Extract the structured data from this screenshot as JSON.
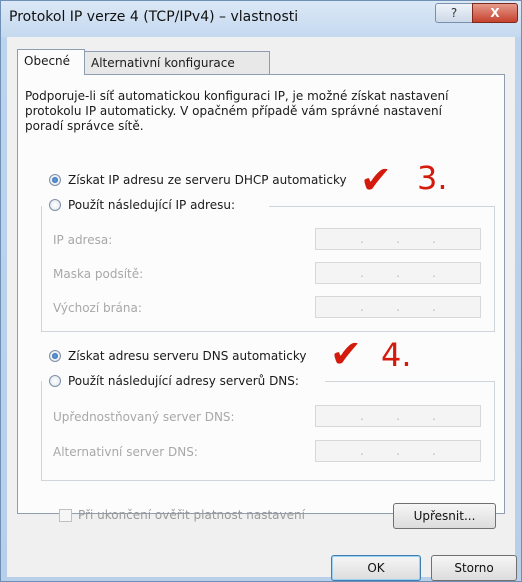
{
  "window": {
    "title": "Protokol IP verze 4 (TCP/IPv4) – vlastnosti",
    "help_label": "?",
    "close_label": "X"
  },
  "tabs": [
    {
      "label": "Obecné",
      "active": true
    },
    {
      "label": "Alternativní konfigurace",
      "active": false
    }
  ],
  "description": "Podporuje-li síť automatickou konfiguraci IP, je možné získat nastavení protokolu IP automaticky. V opačném případě vám správné nastavení poradí správce sítě.",
  "ip_section": {
    "auto_label": "Získat IP adresu ze serveru DHCP automaticky",
    "manual_label": "Použít následující IP adresu:",
    "fields": [
      {
        "label": "IP adresa:",
        "value": ". . ."
      },
      {
        "label": "Maska podsítě:",
        "value": ". . ."
      },
      {
        "label": "Výchozí brána:",
        "value": ". . ."
      }
    ],
    "auto_selected": true
  },
  "dns_section": {
    "auto_label": "Získat adresu serveru DNS automaticky",
    "manual_label": "Použít následující adresy serverů DNS:",
    "fields": [
      {
        "label": "Upřednostňovaný server DNS:",
        "value": ". . ."
      },
      {
        "label": "Alternativní server DNS:",
        "value": ". . ."
      }
    ],
    "auto_selected": true
  },
  "validate_label": "Při ukončení ověřit platnost nastavení",
  "buttons": {
    "advanced": "Upřesnit...",
    "ok": "OK",
    "cancel": "Storno"
  },
  "annotations": {
    "step3": "3.",
    "step4": "4.",
    "check_glyph": "✔",
    "color": "#d41a0d"
  }
}
